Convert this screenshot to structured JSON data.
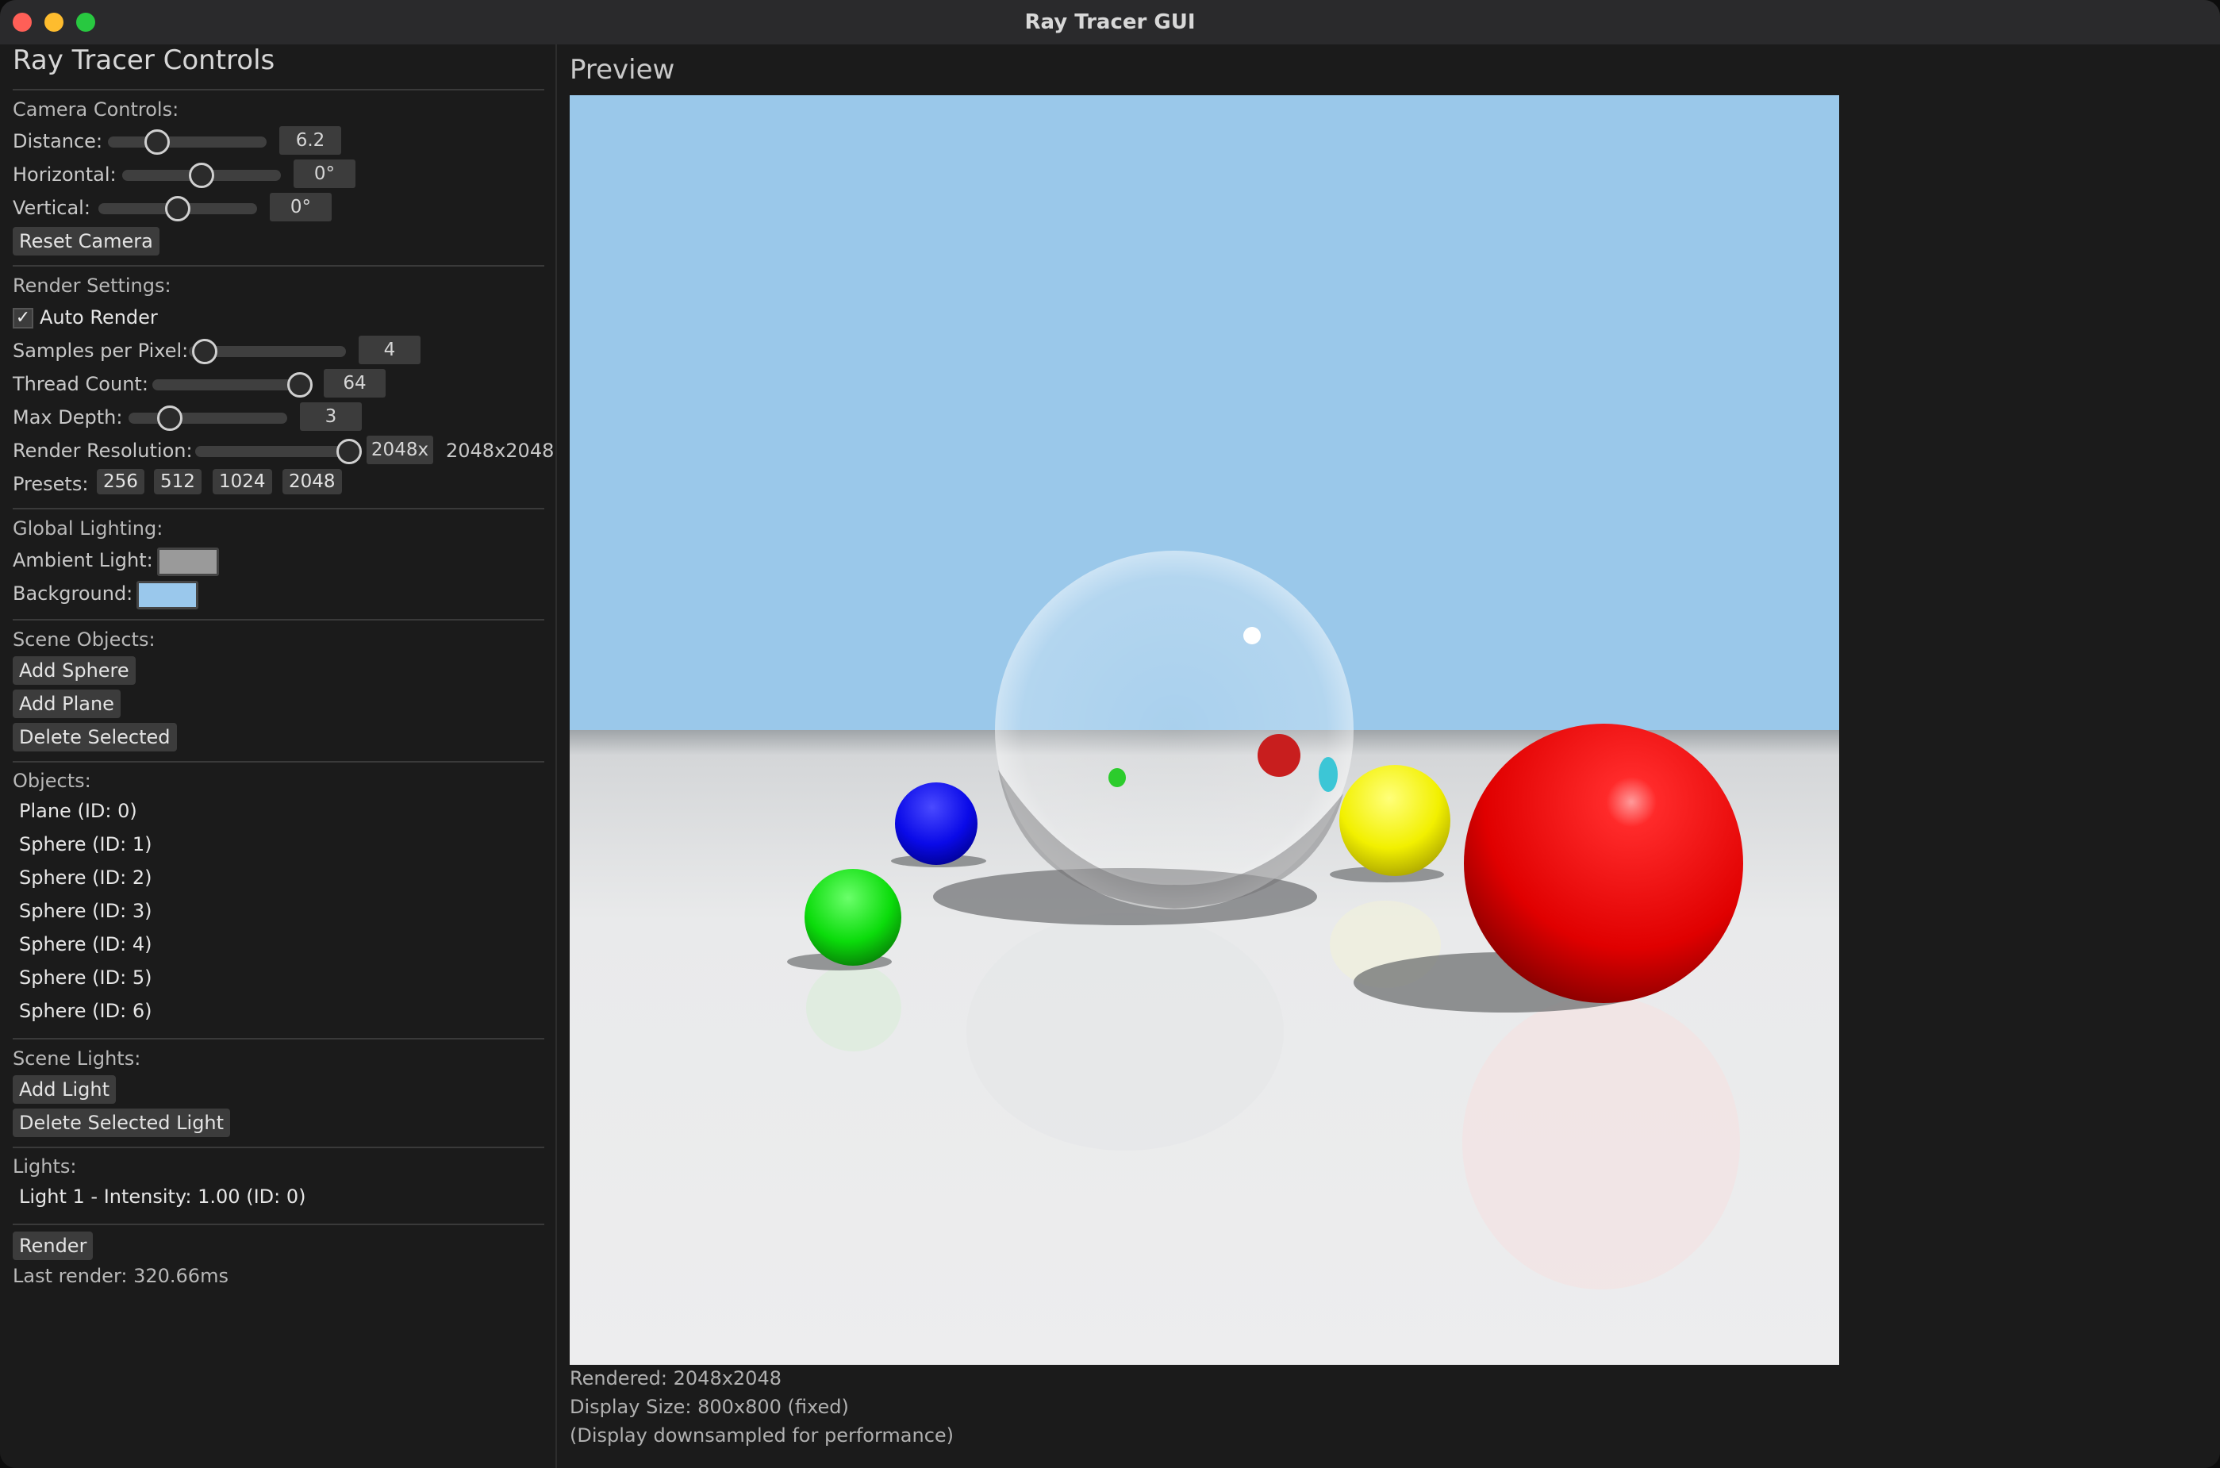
{
  "window": {
    "title": "Ray Tracer GUI"
  },
  "controls": {
    "heading": "Ray Tracer Controls",
    "camera": {
      "label": "Camera Controls:",
      "distance": {
        "label": "Distance:",
        "value": "6.2",
        "level": 0.31
      },
      "horizontal": {
        "label": "Horizontal:",
        "value": "0°",
        "level": 0.5
      },
      "vertical": {
        "label": "Vertical:",
        "value": "0°",
        "level": 0.5
      },
      "reset": "Reset Camera"
    },
    "render": {
      "label": "Render Settings:",
      "auto_render": "Auto Render",
      "auto_render_checked": true,
      "check_mark": "✓",
      "samples": {
        "label": "Samples per Pixel:",
        "value": "4",
        "level": 0.1
      },
      "threads": {
        "label": "Thread Count:",
        "value": "64",
        "level": 0.93
      },
      "depth": {
        "label": "Max Depth:",
        "value": "3",
        "level": 0.26
      },
      "resolution": {
        "label": "Render Resolution:",
        "value": "2048x",
        "display": "2048x2048",
        "level": 0.97
      },
      "presets_label": "Presets:",
      "presets": [
        "256",
        "512",
        "1024",
        "2048"
      ]
    },
    "lighting": {
      "label": "Global Lighting:",
      "ambient": "Ambient Light:",
      "ambient_color": "#9a9a9a",
      "background": "Background:",
      "background_color": "#9ac8ec"
    },
    "scene": {
      "label": "Scene Objects:",
      "add_sphere": "Add Sphere",
      "add_plane": "Add Plane",
      "delete_selected": "Delete Selected"
    },
    "objects": {
      "label": "Objects:",
      "items": [
        "Plane (ID: 0)",
        "Sphere (ID: 1)",
        "Sphere (ID: 2)",
        "Sphere (ID: 3)",
        "Sphere (ID: 4)",
        "Sphere (ID: 5)",
        "Sphere (ID: 6)"
      ]
    },
    "scene_lights": {
      "label": "Scene Lights:",
      "add_light": "Add Light",
      "delete_light": "Delete Selected Light"
    },
    "lights": {
      "label": "Lights:",
      "items": [
        "Light 1 - Intensity: 1.00 (ID: 0)"
      ]
    },
    "render_button": "Render",
    "last_render": "Last render: 320.66ms"
  },
  "preview": {
    "title": "Preview",
    "rendered": "Rendered: 2048x2048",
    "display_size": "Display Size: 800x800 (fixed)",
    "note": "(Display downsampled for performance)"
  }
}
